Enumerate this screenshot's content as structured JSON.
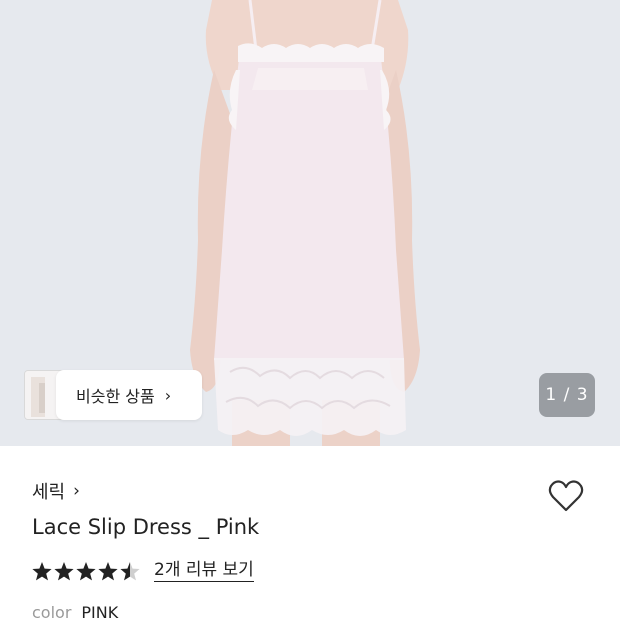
{
  "gallery": {
    "similar_label": "비슷한 상품",
    "page_indicator": "1 / 3"
  },
  "product": {
    "brand": "세릭",
    "name": "Lace Slip Dress _ Pink",
    "rating": 4.5,
    "review_link": "2개 리뷰 보기",
    "option_key": "color",
    "option_value": "PINK"
  },
  "colors": {
    "hero_bg": "#e6e9ee",
    "dress": "#f3e8ee",
    "skin": "#efd6cc",
    "star": "#222222"
  },
  "icons": {
    "similar_chevron": "chevron-right-icon",
    "brand_chevron": "chevron-right-icon",
    "wishlist": "heart-outline-icon"
  }
}
